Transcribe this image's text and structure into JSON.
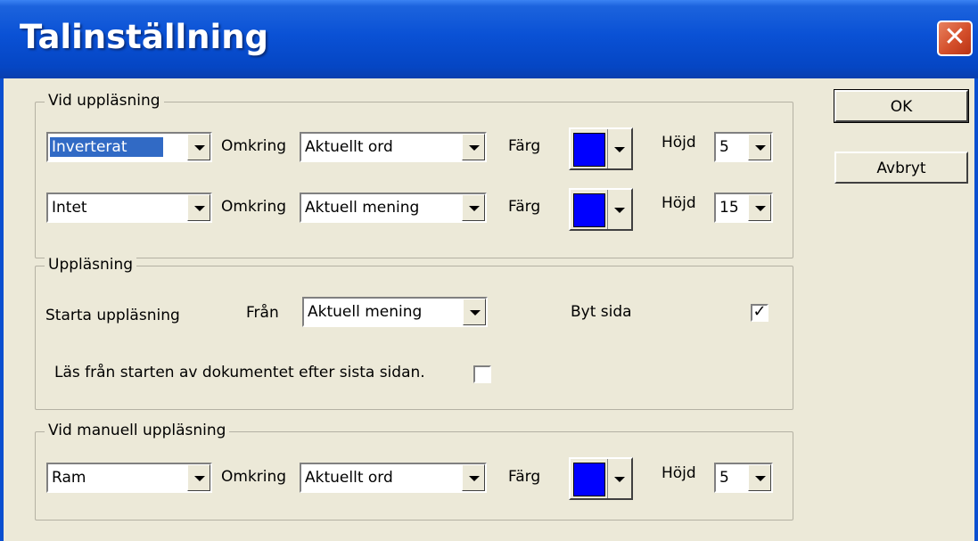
{
  "window": {
    "title": "Talinställning",
    "close_glyph": "✕"
  },
  "buttons": {
    "ok": "OK",
    "cancel": "Avbryt"
  },
  "group1": {
    "legend": "Vid uppläsning",
    "rows": [
      {
        "style": "Inverterat",
        "omkring_label": "Omkring",
        "omkring": "Aktuellt ord",
        "farg_label": "Färg",
        "hojd_label": "Höjd",
        "hojd": "5",
        "color": "#0000ff"
      },
      {
        "style": "Intet",
        "omkring_label": "Omkring",
        "omkring": "Aktuell mening",
        "farg_label": "Färg",
        "hojd_label": "Höjd",
        "hojd": "15",
        "color": "#0000ff"
      }
    ]
  },
  "group2": {
    "legend": "Uppläsning",
    "start_label": "Starta uppläsning",
    "fran_label": "Från",
    "fran": "Aktuell mening",
    "byt_sida_label": "Byt sida",
    "byt_sida_checked": true,
    "check_glyph": "✓",
    "read_from_start_label": "Läs från starten av dokumentet efter sista sidan.",
    "read_from_start_checked": false
  },
  "group3": {
    "legend": "Vid manuell uppläsning",
    "row": {
      "style": "Ram",
      "omkring_label": "Omkring",
      "omkring": "Aktuellt ord",
      "farg_label": "Färg",
      "hojd_label": "Höjd",
      "hojd": "5",
      "color": "#0000ff"
    }
  }
}
